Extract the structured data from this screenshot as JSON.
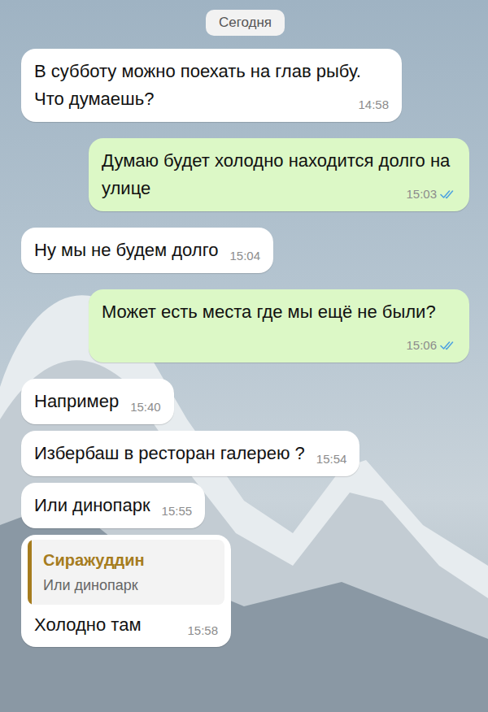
{
  "chat": {
    "date_pill": "Сегодня"
  },
  "messages": [
    {
      "direction": "incoming",
      "text": "В субботу можно поехать на глав рыбу. Что думаешь?",
      "time": "14:58",
      "receipt": "none"
    },
    {
      "direction": "outgoing",
      "text": "Думаю будет холодно находится долго на улице",
      "time": "15:03",
      "receipt": "read"
    },
    {
      "direction": "incoming",
      "text": "Ну мы не будем долго",
      "time": "15:04",
      "receipt": "none"
    },
    {
      "direction": "outgoing",
      "text": "Может есть места где мы ещё не были?",
      "time": "15:06",
      "receipt": "read"
    },
    {
      "direction": "incoming",
      "text": "Например",
      "time": "15:40",
      "receipt": "none"
    },
    {
      "direction": "incoming",
      "text": "Избербаш в ресторан галерею ?",
      "time": "15:54",
      "receipt": "none"
    },
    {
      "direction": "incoming",
      "text": "Или динопарк",
      "time": "15:55",
      "receipt": "none"
    },
    {
      "direction": "incoming",
      "text": "Холодно там",
      "time": "15:58",
      "receipt": "none",
      "reply_to": {
        "author": "Сиражуддин",
        "text": "Или динопарк"
      }
    }
  ]
}
